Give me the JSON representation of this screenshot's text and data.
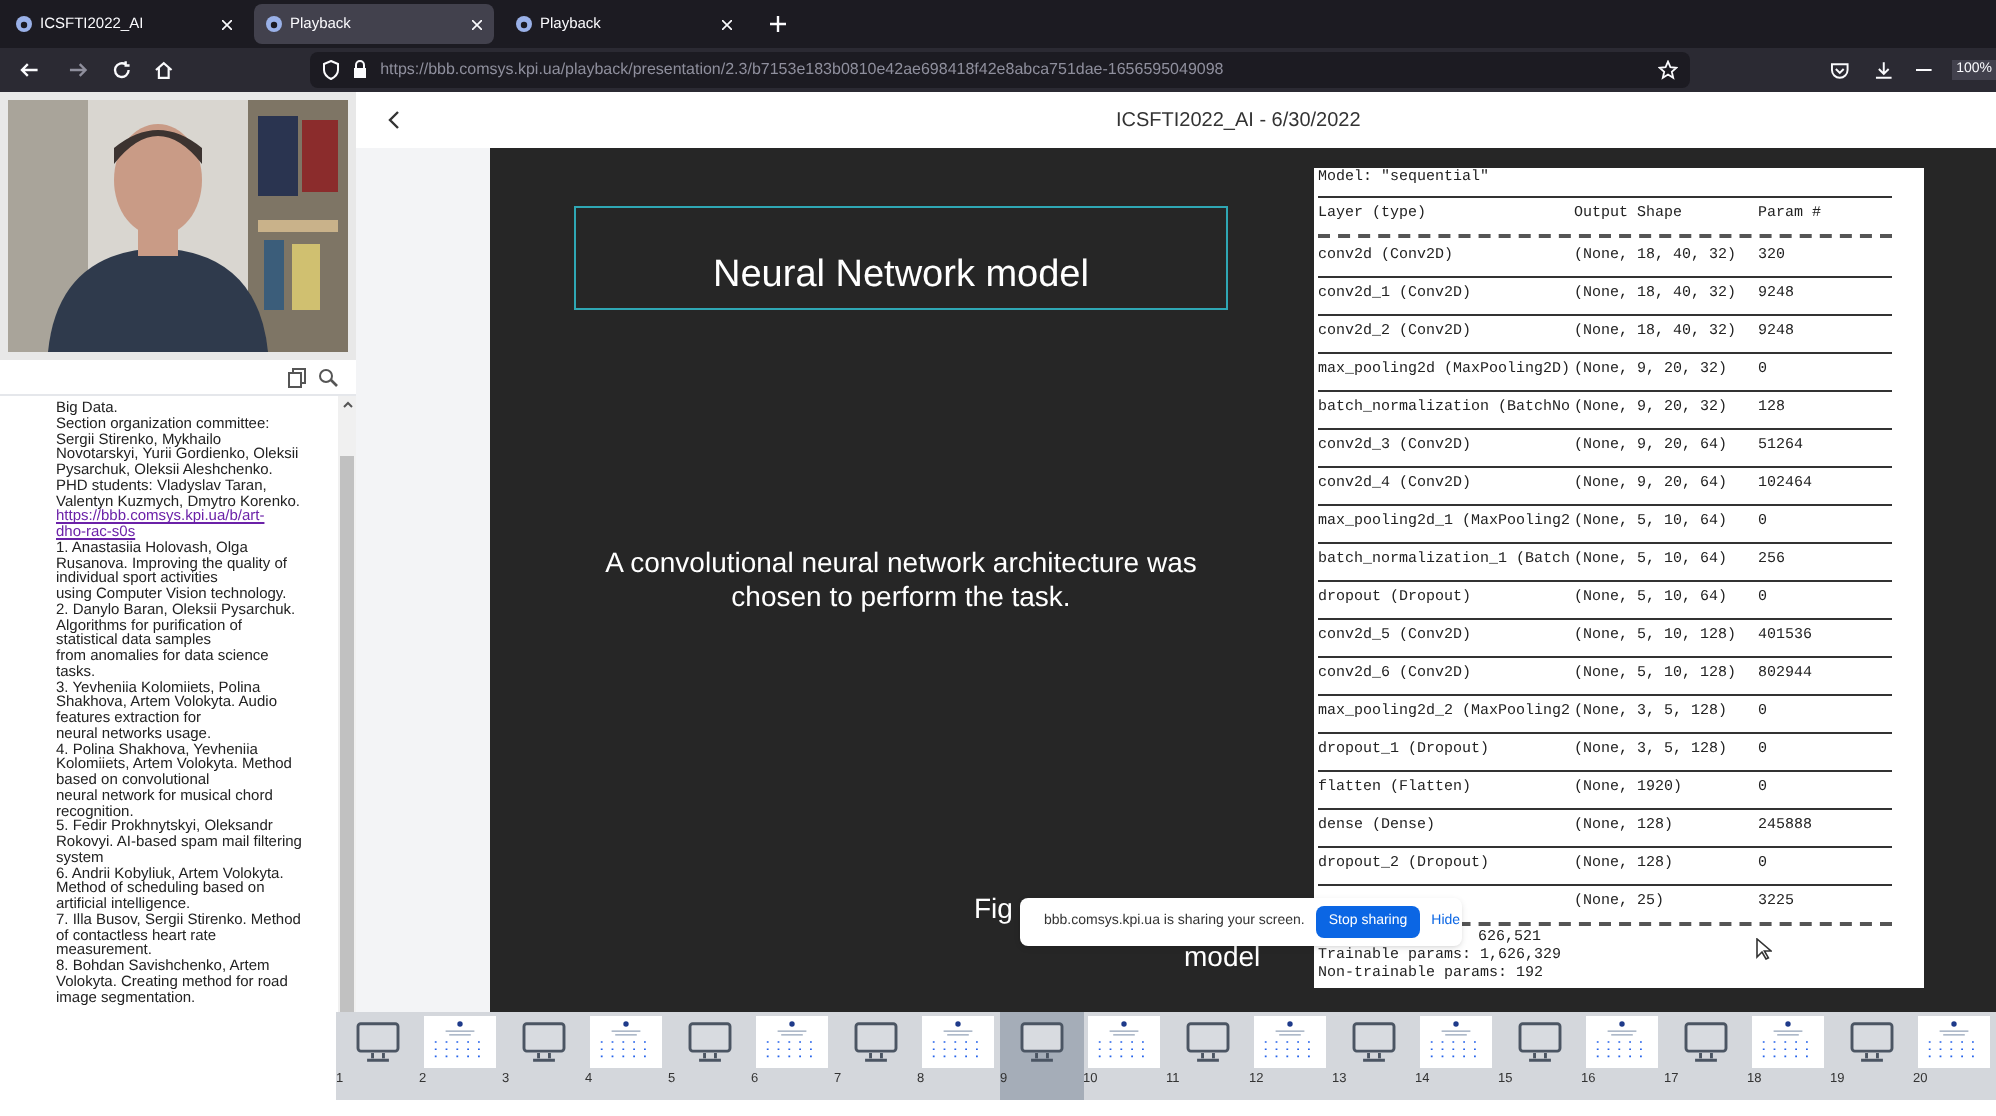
{
  "browser": {
    "tabs": [
      {
        "label": "ICSFTI2022_AI",
        "selected": false
      },
      {
        "label": "Playback",
        "selected": true
      },
      {
        "label": "Playback",
        "selected": false
      }
    ],
    "url": "https://bbb.comsys.kpi.ua/playback/presentation/2.3/b7153e183b0810e42ae698418f42e8abca751dae-1656595049098",
    "zoom": "100%"
  },
  "chat": {
    "lines": [
      {
        "text": "Big Data."
      },
      {
        "text": "Section organization committee:"
      },
      {
        "text": "Sergii Stirenko, Mykhailo"
      },
      {
        "text": "Novotarskyi, Yurii Gordienko, Oleksii"
      },
      {
        "text": "Pysarchuk, Oleksii Aleshchenko."
      },
      {
        "text": "PHD students: Vladyslav Taran,"
      },
      {
        "text": "Valentyn Kuzmych, Dmytro Korenko."
      },
      {
        "text": "https://bbb.comsys.kpi.ua/b/art-",
        "kind": "link"
      },
      {
        "text": "dho-rac-s0s",
        "kind": "link"
      },
      {
        "text": "1. Anastasiia Holovash, Olga"
      },
      {
        "text": "Rusanova. Improving the quality of"
      },
      {
        "text": "individual sport activities"
      },
      {
        "text": "using Computer Vision technology."
      },
      {
        "text": "2. Danylo Baran, Oleksii Pysarchuk."
      },
      {
        "text": "Algorithms for purification of"
      },
      {
        "text": "statistical data samples"
      },
      {
        "text": "from anomalies for data science"
      },
      {
        "text": "tasks."
      },
      {
        "text": "3. Yevheniia Kolomiiets, Polina"
      },
      {
        "text": "Shakhova, Artem Volokyta. Audio"
      },
      {
        "text": "features extraction for"
      },
      {
        "text": "neural networks usage."
      },
      {
        "text": "4. Polina Shakhova, Yevheniia"
      },
      {
        "text": "Kolomiiets, Artem Volokyta. Method"
      },
      {
        "text": "based on convolutional"
      },
      {
        "text": "neural network for musical chord"
      },
      {
        "text": "recognition."
      },
      {
        "text": "5. Fedir Prokhnytskyi, Oleksandr"
      },
      {
        "text": "Rokovyi. AI-based spam mail filtering"
      },
      {
        "text": "system"
      },
      {
        "text": "6. Andrii Kobyliuk, Artem Volokyta."
      },
      {
        "text": "Method of scheduling based on"
      },
      {
        "text": "artificial intelligence."
      },
      {
        "text": "7. Illa Busov, Sergii Stirenko. Method"
      },
      {
        "text": "of contactless heart rate"
      },
      {
        "text": "measurement."
      },
      {
        "text": "8. Bohdan Savishchenko, Artem"
      },
      {
        "text": "Volokyta. Creating method for road"
      },
      {
        "text": "image segmentation."
      }
    ]
  },
  "header": {
    "title": "ICSFTI2022_AI - 6/30/2022"
  },
  "slide": {
    "title": "Neural Network model",
    "body": "A convolutional neural network architecture was chosen to perform the task.",
    "caption_parts": [
      "Fig",
      "model"
    ],
    "summary_title": "Model: \"sequential\"",
    "columns": [
      "Layer (type)",
      "Output Shape",
      "Param #"
    ],
    "rows": [
      {
        "layer": "conv2d (Conv2D)",
        "shape": "(None, 18, 40, 32)",
        "params": "320"
      },
      {
        "layer": "conv2d_1 (Conv2D)",
        "shape": "(None, 18, 40, 32)",
        "params": "9248"
      },
      {
        "layer": "conv2d_2 (Conv2D)",
        "shape": "(None, 18, 40, 32)",
        "params": "9248"
      },
      {
        "layer": "max_pooling2d (MaxPooling2D)",
        "shape": "(None, 9, 20, 32)",
        "params": "0"
      },
      {
        "layer": "batch_normalization (BatchNo",
        "shape": "(None, 9, 20, 32)",
        "params": "128"
      },
      {
        "layer": "conv2d_3 (Conv2D)",
        "shape": "(None, 9, 20, 64)",
        "params": "51264"
      },
      {
        "layer": "conv2d_4 (Conv2D)",
        "shape": "(None, 9, 20, 64)",
        "params": "102464"
      },
      {
        "layer": "max_pooling2d_1 (MaxPooling2",
        "shape": "(None, 5, 10, 64)",
        "params": "0"
      },
      {
        "layer": "batch_normalization_1 (Batch",
        "shape": "(None, 5, 10, 64)",
        "params": "256"
      },
      {
        "layer": "dropout (Dropout)",
        "shape": "(None, 5, 10, 64)",
        "params": "0"
      },
      {
        "layer": "conv2d_5 (Conv2D)",
        "shape": "(None, 5, 10, 128)",
        "params": "401536"
      },
      {
        "layer": "conv2d_6 (Conv2D)",
        "shape": "(None, 5, 10, 128)",
        "params": "802944"
      },
      {
        "layer": "max_pooling2d_2 (MaxPooling2",
        "shape": "(None, 3, 5, 128)",
        "params": "0"
      },
      {
        "layer": "dropout_1 (Dropout)",
        "shape": "(None, 3, 5, 128)",
        "params": "0"
      },
      {
        "layer": "flatten (Flatten)",
        "shape": "(None, 1920)",
        "params": "0"
      },
      {
        "layer": "dense (Dense)",
        "shape": "(None, 128)",
        "params": "245888"
      },
      {
        "layer": "dropout_2 (Dropout)",
        "shape": "(None, 128)",
        "params": "0"
      },
      {
        "shape": "(None, 25)",
        "params": "3225"
      }
    ],
    "totals": [
      "626,521",
      "Trainable params: 1,626,329",
      "Non-trainable params: 192"
    ]
  },
  "sharing_bar": {
    "message": "bbb.comsys.kpi.ua is sharing your screen.",
    "stop": "Stop sharing",
    "hide": "Hide"
  },
  "thumbnails": [
    {
      "number": "1",
      "kind": "screen",
      "selected": false
    },
    {
      "number": "2",
      "kind": "slide",
      "selected": false
    },
    {
      "number": "3",
      "kind": "screen",
      "selected": false
    },
    {
      "number": "4",
      "kind": "slide",
      "selected": false
    },
    {
      "number": "5",
      "kind": "screen",
      "selected": false
    },
    {
      "number": "6",
      "kind": "slide",
      "selected": false
    },
    {
      "number": "7",
      "kind": "screen",
      "selected": false
    },
    {
      "number": "8",
      "kind": "slide",
      "selected": false
    },
    {
      "number": "9",
      "kind": "screen",
      "selected": true
    },
    {
      "number": "10",
      "kind": "slide",
      "selected": false
    },
    {
      "number": "11",
      "kind": "screen",
      "selected": false
    },
    {
      "number": "12",
      "kind": "slide",
      "selected": false
    },
    {
      "number": "13",
      "kind": "screen",
      "selected": false
    },
    {
      "number": "14",
      "kind": "slide",
      "selected": false
    },
    {
      "number": "15",
      "kind": "screen",
      "selected": false
    },
    {
      "number": "16",
      "kind": "slide",
      "selected": false
    },
    {
      "number": "17",
      "kind": "screen",
      "selected": false
    },
    {
      "number": "18",
      "kind": "slide",
      "selected": false
    },
    {
      "number": "19",
      "kind": "screen",
      "selected": false
    },
    {
      "number": "20",
      "kind": "slide",
      "selected": false
    }
  ]
}
